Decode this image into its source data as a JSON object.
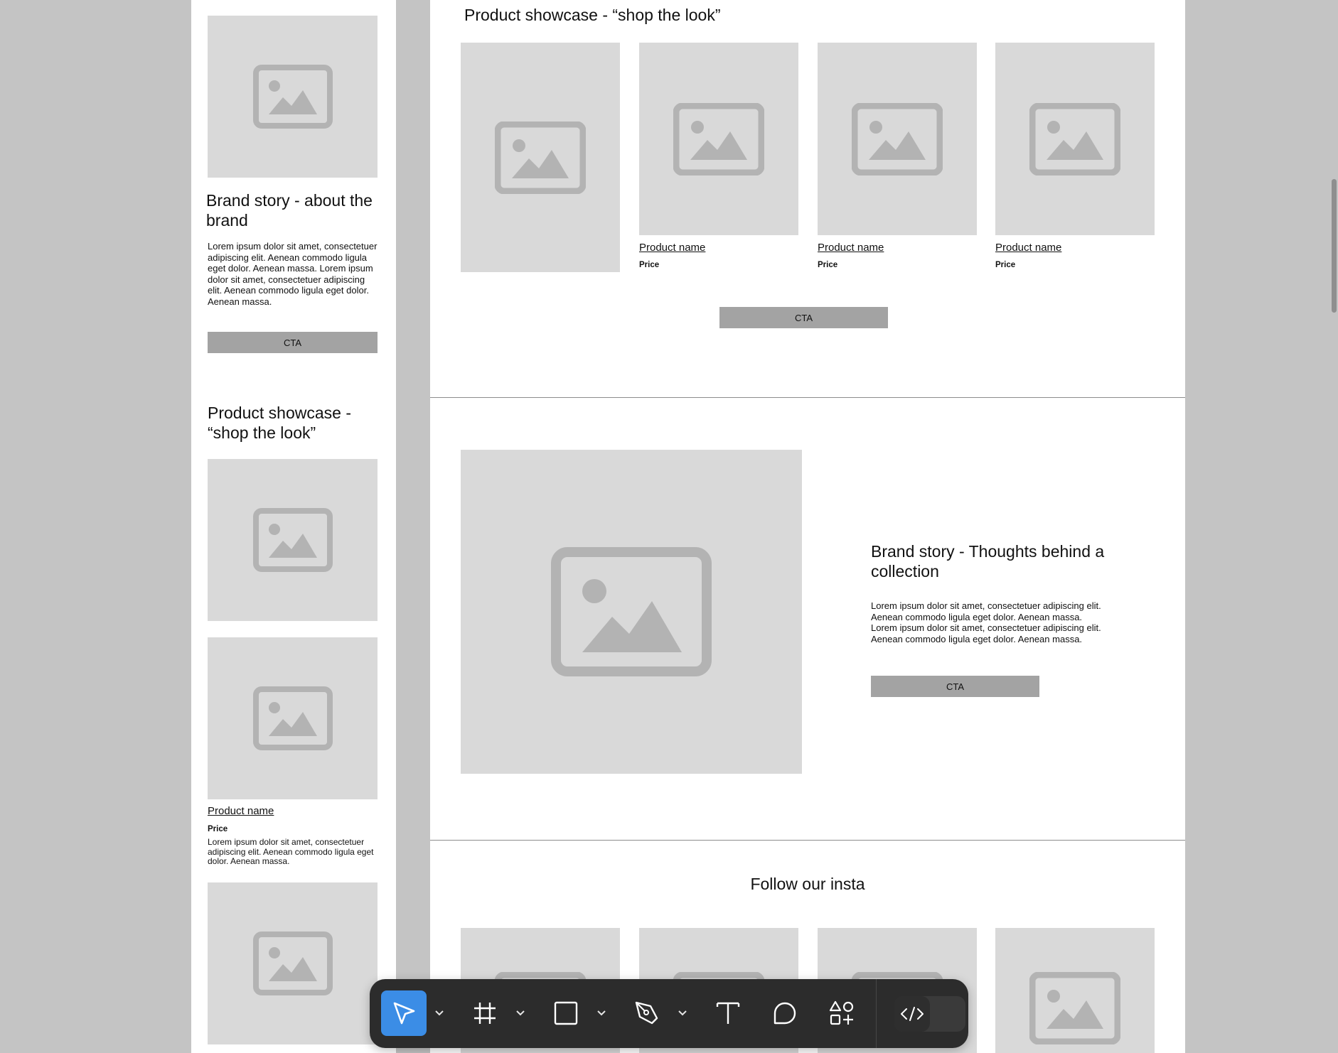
{
  "mobile": {
    "brand_story": {
      "title": "Brand story - about the brand",
      "body": "Lorem ipsum dolor sit amet, consectetuer adipiscing elit. Aenean commodo ligula eget dolor. Aenean massa. Lorem ipsum dolor sit amet, consectetuer adipiscing elit. Aenean commodo ligula eget dolor. Aenean massa.",
      "cta": "CTA"
    },
    "showcase": {
      "title": "Product showcase - “shop the look”",
      "product_name": "Product name",
      "price": "Price",
      "description": "Lorem ipsum dolor sit amet, consectetuer adipiscing elit. Aenean commodo ligula eget dolor. Aenean massa."
    }
  },
  "desktop": {
    "showcase": {
      "title": "Product showcase - “shop the look”",
      "products": [
        {
          "name": "Product name",
          "price": "Price"
        },
        {
          "name": "Product name",
          "price": "Price"
        },
        {
          "name": "Product name",
          "price": "Price"
        }
      ],
      "cta": "CTA"
    },
    "brand_story": {
      "title": "Brand story - Thoughts behind a collection",
      "body": "Lorem ipsum dolor sit amet, consectetuer adipiscing elit. Aenean commodo ligula eget dolor. Aenean massa. Lorem ipsum dolor sit amet, consectetuer adipiscing elit. Aenean commodo ligula eget dolor. Aenean massa.",
      "cta": "CTA"
    },
    "instagram": {
      "title": "Follow our insta"
    }
  },
  "toolbar": {
    "tools": [
      "move-tool",
      "frame-tool",
      "shape-tool",
      "pen-tool",
      "text-tool",
      "comment-tool",
      "actions-tool"
    ],
    "active_tool": "move-tool",
    "accent_color": "#3b8de6"
  },
  "colors": {
    "canvas": "#c4c4c4",
    "placeholder": "#d9d9d9",
    "placeholder_icon": "#b3b3b3",
    "cta": "#a3a3a3",
    "toolbar": "#2c2c2c"
  }
}
